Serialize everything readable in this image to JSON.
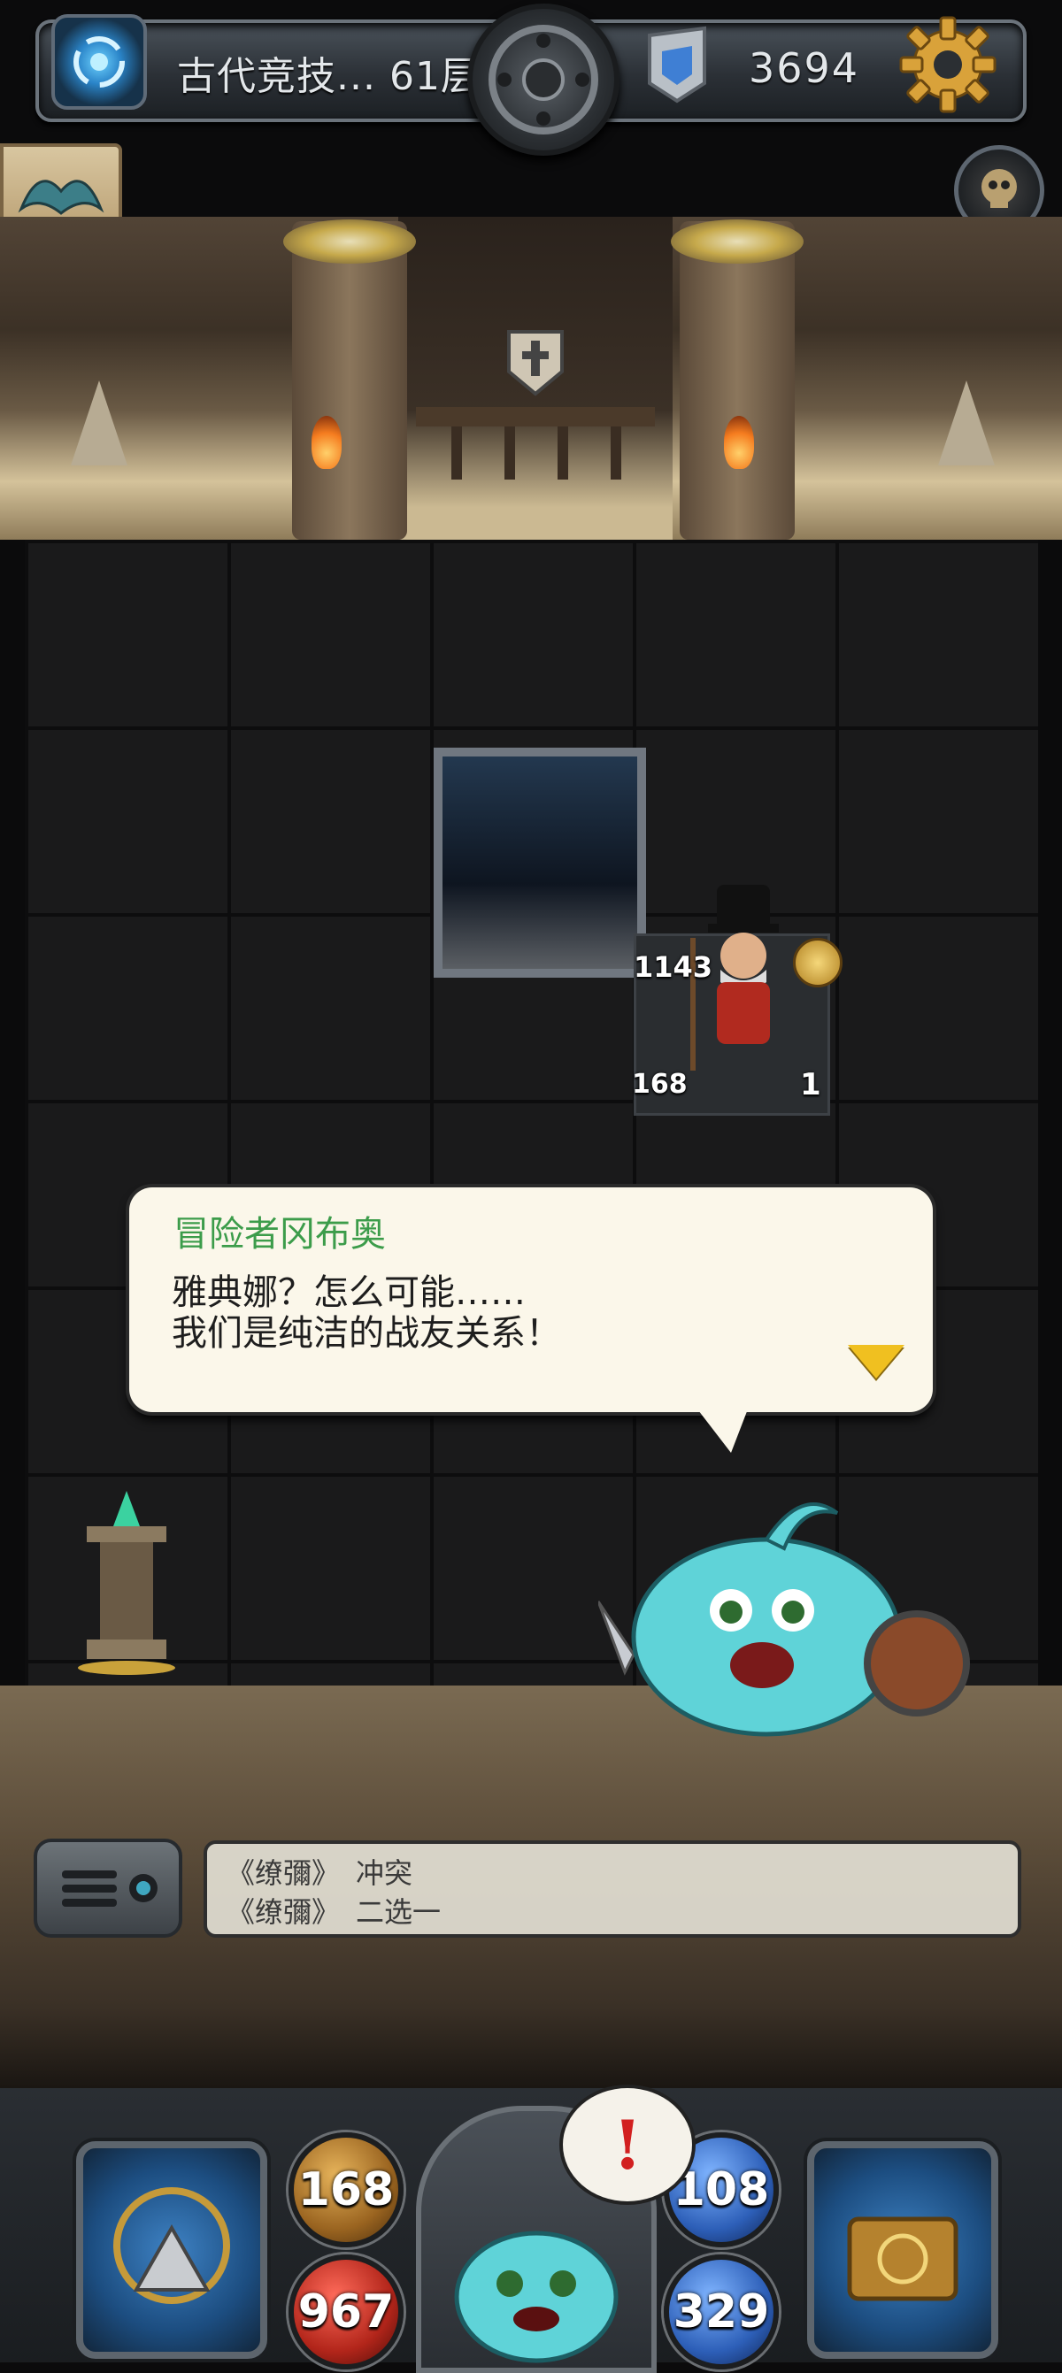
{
  "top_bar": {
    "floor_label": "古代竞技... 61层",
    "gold": "3694",
    "icons": {
      "left": "portal-icon",
      "center": "medallion-icon",
      "gem": "gem-shield-icon",
      "right": "gear-icon"
    }
  },
  "side_buttons": {
    "left": "bat-wing-icon",
    "right": "skull-icon"
  },
  "enemy": {
    "hp": "1143",
    "attack": "168",
    "turns": "1"
  },
  "dialog": {
    "speaker": "冒险者冈布奥",
    "line1": "雅典娜？怎么可能……",
    "line2": "我们是纯洁的战友关系！"
  },
  "log": {
    "rows": [
      {
        "tag": "《缭彌》",
        "text": "冲突"
      },
      {
        "tag": "《缭彌》",
        "text": "二选一"
      }
    ]
  },
  "hud": {
    "attack": "168",
    "hp": "967",
    "defense": "108",
    "mp": "329",
    "alert": "!",
    "colors": {
      "attack": "#b07a2a",
      "hp": "#c52a1f",
      "defense": "#3a6fc8",
      "mp": "#2d5fb8"
    }
  }
}
